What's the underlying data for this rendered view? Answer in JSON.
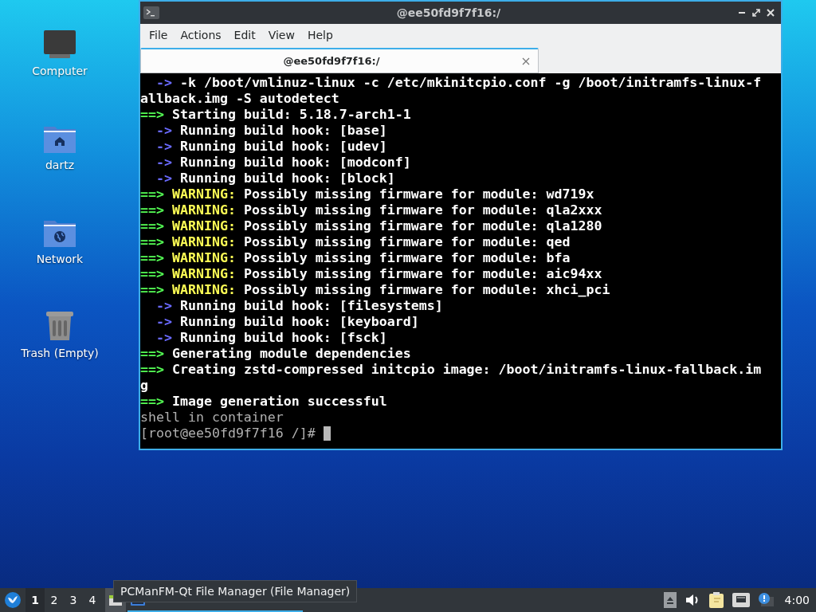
{
  "desktop_icons": [
    {
      "kind": "computer",
      "label": "Computer"
    },
    {
      "kind": "home",
      "label": "dartz"
    },
    {
      "kind": "network",
      "label": "Network"
    },
    {
      "kind": "trash",
      "label": "Trash (Empty)"
    }
  ],
  "window": {
    "title": "@ee50fd9f7f16:/",
    "menu": [
      "File",
      "Actions",
      "Edit",
      "View",
      "Help"
    ],
    "tabs": [
      {
        "label": "@ee50fd9f7f16:/",
        "selected": true
      }
    ]
  },
  "terminal": {
    "lines": [
      {
        "kind": "step",
        "marker": "->",
        "text": "-k /boot/vmlinuz-linux -c /etc/mkinitcpio.conf -g /boot/initramfs-linux-f"
      },
      {
        "kind": "plain",
        "text": "allback.img -S autodetect"
      },
      {
        "kind": "info",
        "marker": "==>",
        "text": "Starting build: 5.18.7-arch1-1"
      },
      {
        "kind": "step",
        "marker": "->",
        "text": "Running build hook: [base]"
      },
      {
        "kind": "step",
        "marker": "->",
        "text": "Running build hook: [udev]"
      },
      {
        "kind": "step",
        "marker": "->",
        "text": "Running build hook: [modconf]"
      },
      {
        "kind": "step",
        "marker": "->",
        "text": "Running build hook: [block]"
      },
      {
        "kind": "warning",
        "marker": "==>",
        "label": "WARNING:",
        "text": "Possibly missing firmware for module: wd719x"
      },
      {
        "kind": "warning",
        "marker": "==>",
        "label": "WARNING:",
        "text": "Possibly missing firmware for module: qla2xxx"
      },
      {
        "kind": "warning",
        "marker": "==>",
        "label": "WARNING:",
        "text": "Possibly missing firmware for module: qla1280"
      },
      {
        "kind": "warning",
        "marker": "==>",
        "label": "WARNING:",
        "text": "Possibly missing firmware for module: qed"
      },
      {
        "kind": "warning",
        "marker": "==>",
        "label": "WARNING:",
        "text": "Possibly missing firmware for module: bfa"
      },
      {
        "kind": "warning",
        "marker": "==>",
        "label": "WARNING:",
        "text": "Possibly missing firmware for module: aic94xx"
      },
      {
        "kind": "warning",
        "marker": "==>",
        "label": "WARNING:",
        "text": "Possibly missing firmware for module: xhci_pci"
      },
      {
        "kind": "step",
        "marker": "->",
        "text": "Running build hook: [filesystems]"
      },
      {
        "kind": "step",
        "marker": "->",
        "text": "Running build hook: [keyboard]"
      },
      {
        "kind": "step",
        "marker": "->",
        "text": "Running build hook: [fsck]"
      },
      {
        "kind": "info",
        "marker": "==>",
        "text": "Generating module dependencies"
      },
      {
        "kind": "info",
        "marker": "==>",
        "text": "Creating zstd-compressed initcpio image: /boot/initramfs-linux-fallback.im"
      },
      {
        "kind": "plain",
        "text": "g"
      },
      {
        "kind": "info",
        "marker": "==>",
        "text": "Image generation successful"
      },
      {
        "kind": "dim",
        "text": "shell in container"
      },
      {
        "kind": "prompt",
        "text": "[root@ee50fd9f7f16 /]#"
      }
    ]
  },
  "taskbar": {
    "workspaces": [
      {
        "label": "1",
        "selected": true
      },
      {
        "label": "2",
        "selected": false
      },
      {
        "label": "3",
        "selected": false
      },
      {
        "label": "4",
        "selected": false
      }
    ],
    "tasks": [
      {
        "kind": "file-manager",
        "selected": false
      },
      {
        "kind": "terminal",
        "selected": true
      }
    ],
    "tooltip": "PCManFM-Qt File Manager (File Manager)",
    "clock": "4:00"
  }
}
